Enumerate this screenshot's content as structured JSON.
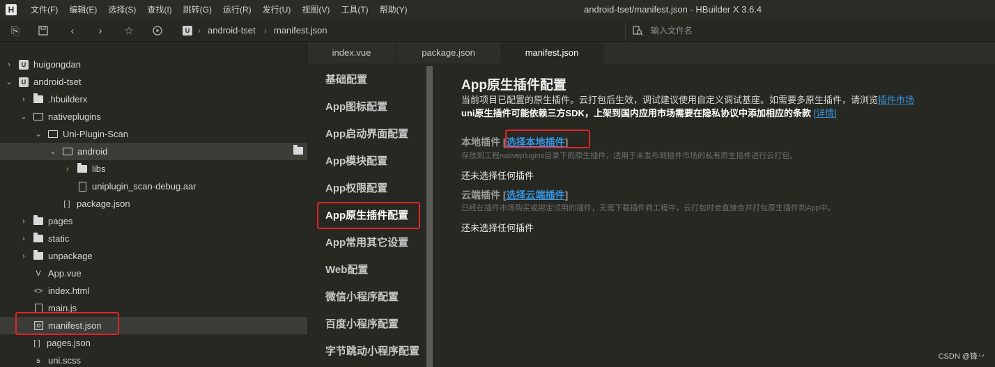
{
  "app": {
    "logo": "H",
    "window_title": "android-tset/manifest.json - HBuilder X 3.6.4"
  },
  "menu": [
    "文件(F)",
    "编辑(E)",
    "选择(S)",
    "查找(I)",
    "跳转(G)",
    "运行(R)",
    "发行(U)",
    "视图(V)",
    "工具(T)",
    "帮助(Y)"
  ],
  "toolbar": {
    "breadcrumb": [
      "android-tset",
      "manifest.json"
    ],
    "project_badge": "U",
    "search_placeholder": "输入文件名"
  },
  "tree": [
    {
      "label": "huigongdan",
      "icon": "project-icon",
      "arrow": "›",
      "depth": 0
    },
    {
      "label": "android-tset",
      "icon": "project-icon",
      "arrow": "⌄",
      "depth": 0
    },
    {
      "label": ".hbuilderx",
      "icon": "folder-icon",
      "arrow": "›",
      "depth": 1
    },
    {
      "label": "nativeplugins",
      "icon": "folder-open-icon",
      "arrow": "⌄",
      "depth": 1
    },
    {
      "label": "Uni-Plugin-Scan",
      "icon": "folder-open-icon",
      "arrow": "⌄",
      "depth": 2
    },
    {
      "label": "android",
      "icon": "folder-open-icon",
      "arrow": "⌄",
      "depth": 3,
      "selected": true
    },
    {
      "label": "libs",
      "icon": "folder-icon",
      "arrow": "›",
      "depth": 4
    },
    {
      "label": "uniplugin_scan-debug.aar",
      "icon": "file-icon",
      "arrow": "",
      "depth": 4
    },
    {
      "label": "package.json",
      "icon": "json-icon",
      "arrow": "",
      "depth": 3
    },
    {
      "label": "pages",
      "icon": "folder-icon",
      "arrow": "›",
      "depth": 1
    },
    {
      "label": "static",
      "icon": "folder-icon",
      "arrow": "›",
      "depth": 1
    },
    {
      "label": "unpackage",
      "icon": "folder-icon",
      "arrow": "›",
      "depth": 1
    },
    {
      "label": "App.vue",
      "icon": "vue-icon",
      "arrow": "",
      "depth": 1
    },
    {
      "label": "index.html",
      "icon": "html-icon",
      "arrow": "",
      "depth": 1
    },
    {
      "label": "main.js",
      "icon": "js-icon",
      "arrow": "",
      "depth": 1
    },
    {
      "label": "manifest.json",
      "icon": "manifest-icon",
      "arrow": "",
      "depth": 1
    },
    {
      "label": "pages.json",
      "icon": "json-icon",
      "arrow": "",
      "depth": 1
    },
    {
      "label": "uni.scss",
      "icon": "scss-icon",
      "arrow": "",
      "depth": 1
    }
  ],
  "tabs": [
    "index.vue",
    "package.json",
    "manifest.json"
  ],
  "active_tab": "manifest.json",
  "settings_nav": [
    "基础配置",
    "App图标配置",
    "App启动界面配置",
    "App模块配置",
    "App权限配置",
    "App原生插件配置",
    "App常用其它设置",
    "Web配置",
    "微信小程序配置",
    "百度小程序配置",
    "字节跳动小程序配置"
  ],
  "active_nav": "App原生插件配置",
  "content": {
    "title": "App原生插件配置",
    "desc_text": "当前项目已配置的原生插件。云打包后生效，调试建议使用自定义调试基座。如需要多原生插件，请浏览",
    "desc_link": "插件市场",
    "desc2_text": "uni原生插件可能依赖三方SDK，上架到国内应用市场需要在隐私协议中添加相应的条款",
    "desc2_link": "[详情]",
    "local": {
      "title": "本地插件",
      "link": "选择本地插件",
      "note": "存放到工程nativeplugins目录下的原生插件，适用于未发布到插件市场的私有原生插件进行云打包。",
      "empty": "还未选择任何插件"
    },
    "cloud": {
      "title": "云端插件",
      "link": "选择云端插件",
      "note": "已经在插件市场购买或绑定试用的插件，无需下载插件到工程中，云打包时会直接合并打包原生插件到App中。",
      "empty": "还未选择任何插件"
    }
  },
  "watermark": "CSDN @锋丷",
  "colors": {
    "highlight": "#e0242c",
    "link": "#3794e0",
    "background": "#272822"
  }
}
